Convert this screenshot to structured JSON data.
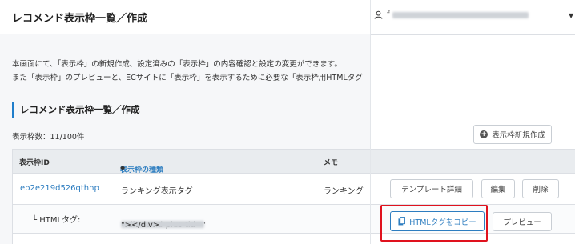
{
  "header": {
    "title": "レコメンド表示枠一覧／作成"
  },
  "description": {
    "line1": "本画面にて、「表示枠」の新規作成、設定済みの「表示枠」の内容確認と設定の変更ができます。",
    "line2": "また「表示枠」のプレビューと、ECサイトに「表示枠」を表示するために必要な「表示枠用HTMLタグ"
  },
  "section": {
    "title": "レコメンド表示枠一覧／作成"
  },
  "count": {
    "label": "表示枠数：11/100件"
  },
  "table": {
    "headers": {
      "id": "表示枠ID",
      "type": "表示枠の種類",
      "sort": "◆",
      "memo": "メモ"
    },
    "row": {
      "id": "eb2e219d526qthnp",
      "type": "ランキング表示タグ",
      "memo": "ランキング"
    },
    "tag_row": {
      "label": "└ HTMLタグ:",
      "code_prefix": "<div rcmd-plus-tid=\"",
      "code_suffix": "\"></div>"
    }
  },
  "user": {
    "name_prefix": "f"
  },
  "buttons": {
    "create": "表示枠新規作成",
    "template_detail": "テンプレート詳細",
    "edit": "編集",
    "delete": "削除",
    "copy_html": "HTMLタグをコピー",
    "preview": "プレビュー"
  },
  "icons": {
    "user": "user-icon",
    "caret": "caret-down-icon",
    "plus": "plus-circle-icon",
    "copy": "copy-icon"
  },
  "colors": {
    "accent": "#2d7dc0",
    "highlight": "#e0121e"
  }
}
